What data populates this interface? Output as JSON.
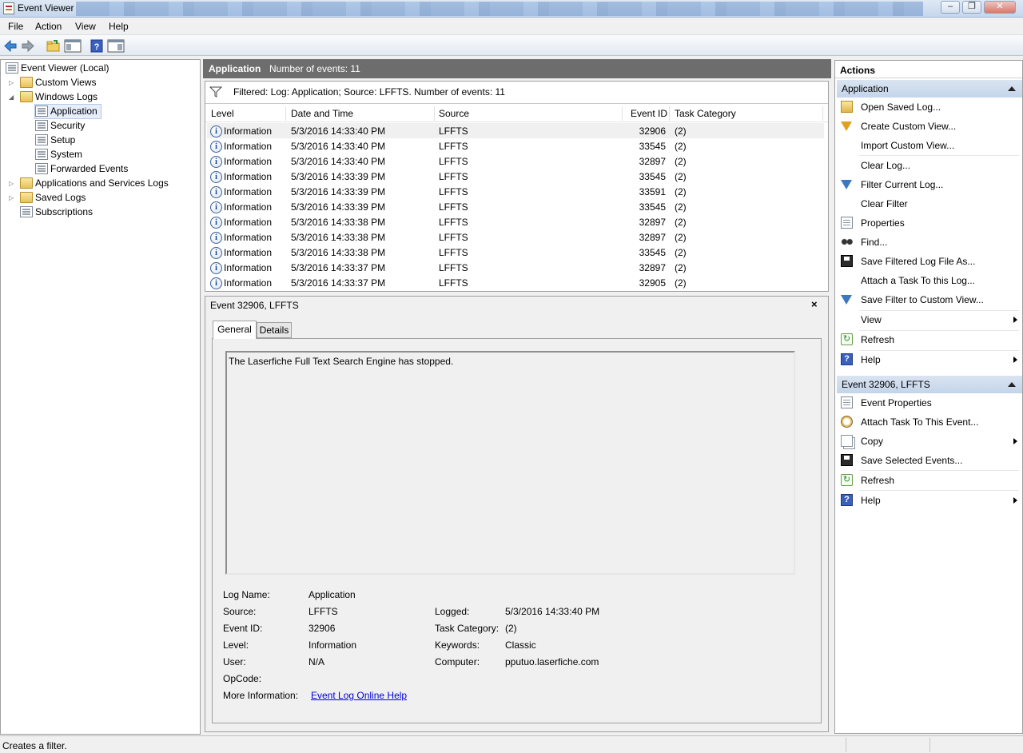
{
  "window": {
    "title": "Event Viewer"
  },
  "menu": [
    "File",
    "Action",
    "View",
    "Help"
  ],
  "toolbar": {
    "buttons": [
      "back-arrow-icon",
      "forward-arrow-icon",
      "open-folder-icon",
      "show-hide-console-tree-icon",
      "help-icon",
      "show-hide-action-pane-icon"
    ]
  },
  "tree": {
    "root": "Event Viewer (Local)",
    "custom_views": "Custom Views",
    "windows_logs": "Windows Logs",
    "logs": [
      "Application",
      "Security",
      "Setup",
      "System",
      "Forwarded Events"
    ],
    "app_services": "Applications and Services Logs",
    "saved_logs": "Saved Logs",
    "subscriptions": "Subscriptions"
  },
  "center": {
    "log_name": "Application",
    "count_text": "Number of events: 11",
    "filter_text": "Filtered: Log: Application; Source: LFFTS. Number of events: 11",
    "columns": [
      "Level",
      "Date and Time",
      "Source",
      "Event ID",
      "Task Category"
    ],
    "rows": [
      {
        "level": "Information",
        "date": "5/3/2016 14:33:40 PM",
        "source": "LFFTS",
        "id": "32906",
        "cat": "(2)"
      },
      {
        "level": "Information",
        "date": "5/3/2016 14:33:40 PM",
        "source": "LFFTS",
        "id": "33545",
        "cat": "(2)"
      },
      {
        "level": "Information",
        "date": "5/3/2016 14:33:40 PM",
        "source": "LFFTS",
        "id": "32897",
        "cat": "(2)"
      },
      {
        "level": "Information",
        "date": "5/3/2016 14:33:39 PM",
        "source": "LFFTS",
        "id": "33545",
        "cat": "(2)"
      },
      {
        "level": "Information",
        "date": "5/3/2016 14:33:39 PM",
        "source": "LFFTS",
        "id": "33591",
        "cat": "(2)"
      },
      {
        "level": "Information",
        "date": "5/3/2016 14:33:39 PM",
        "source": "LFFTS",
        "id": "33545",
        "cat": "(2)"
      },
      {
        "level": "Information",
        "date": "5/3/2016 14:33:38 PM",
        "source": "LFFTS",
        "id": "32897",
        "cat": "(2)"
      },
      {
        "level": "Information",
        "date": "5/3/2016 14:33:38 PM",
        "source": "LFFTS",
        "id": "32897",
        "cat": "(2)"
      },
      {
        "level": "Information",
        "date": "5/3/2016 14:33:38 PM",
        "source": "LFFTS",
        "id": "33545",
        "cat": "(2)"
      },
      {
        "level": "Information",
        "date": "5/3/2016 14:33:37 PM",
        "source": "LFFTS",
        "id": "32897",
        "cat": "(2)"
      },
      {
        "level": "Information",
        "date": "5/3/2016 14:33:37 PM",
        "source": "LFFTS",
        "id": "32905",
        "cat": "(2)"
      }
    ]
  },
  "detail": {
    "title": "Event 32906, LFFTS",
    "close": "×",
    "tabs": [
      "General",
      "Details"
    ],
    "message": "The Laserfiche Full Text Search Engine has stopped.",
    "labels": {
      "log_name": "Log Name:",
      "source": "Source:",
      "event_id": "Event ID:",
      "level": "Level:",
      "user": "User:",
      "opcode": "OpCode:",
      "more_info": "More Information:",
      "logged": "Logged:",
      "task_category": "Task Category:",
      "keywords": "Keywords:",
      "computer": "Computer:"
    },
    "values": {
      "log_name": "Application",
      "source": "LFFTS",
      "event_id": "32906",
      "level": "Information",
      "user": "N/A",
      "logged": "5/3/2016 14:33:40 PM",
      "task_category": "(2)",
      "keywords": "Classic",
      "computer": "pputuo.laserfiche.com",
      "more_info_link": "Event Log Online Help"
    }
  },
  "actions": {
    "title": "Actions",
    "section1": "Application",
    "items1": [
      "Open Saved Log...",
      "Create Custom View...",
      "Import Custom View...",
      "Clear Log...",
      "Filter Current Log...",
      "Clear Filter",
      "Properties",
      "Find...",
      "Save Filtered Log File As...",
      "Attach a Task To this Log...",
      "Save Filter to Custom View...",
      "View",
      "Refresh",
      "Help"
    ],
    "section2": "Event 32906, LFFTS",
    "items2": [
      "Event Properties",
      "Attach Task To This Event...",
      "Copy",
      "Save Selected Events...",
      "Refresh",
      "Help"
    ]
  },
  "status": {
    "text": "Creates a filter."
  }
}
